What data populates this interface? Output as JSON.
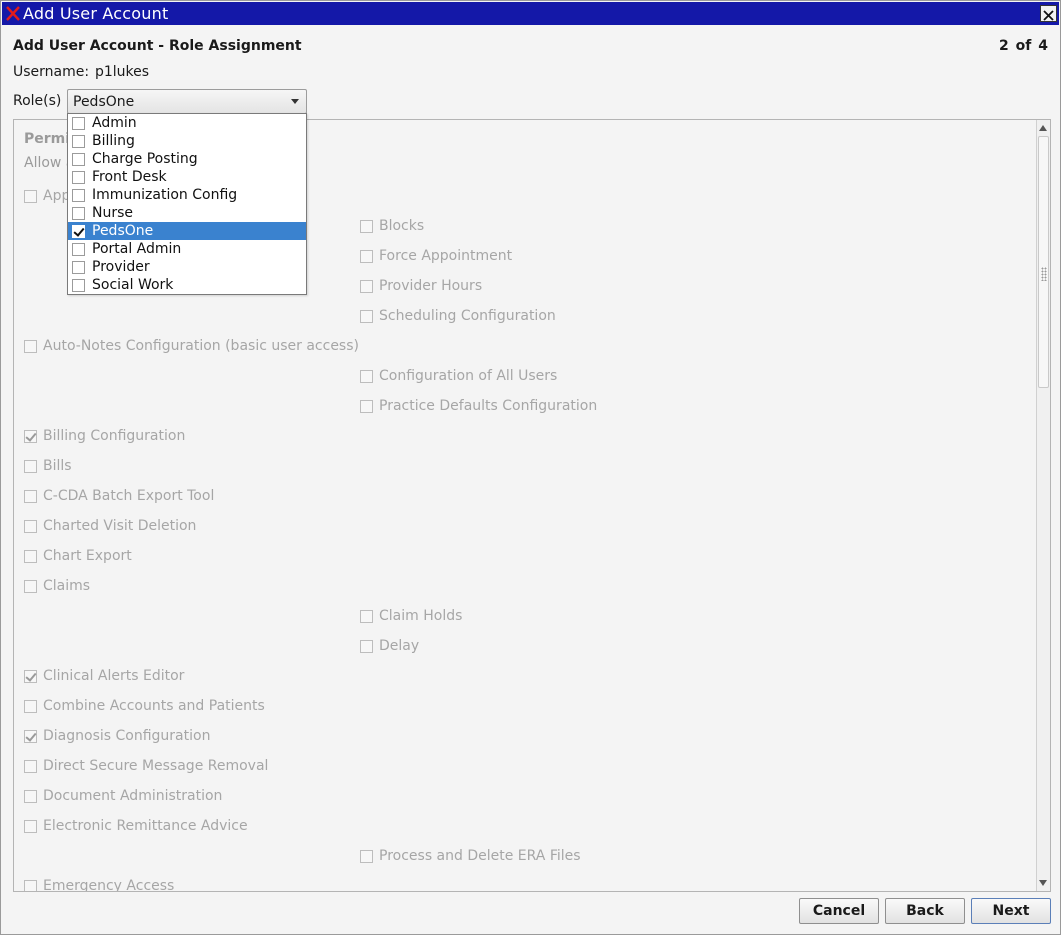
{
  "window": {
    "title": "Add User Account"
  },
  "header": {
    "heading": "Add User Account -  Role Assignment",
    "step": "2 of 4"
  },
  "username": {
    "label": "Username:",
    "value": "p1lukes"
  },
  "roles": {
    "label": "Role(s)",
    "selected": "PedsOne",
    "options": [
      {
        "label": "Admin",
        "checked": false
      },
      {
        "label": "Billing",
        "checked": false
      },
      {
        "label": "Charge Posting",
        "checked": false
      },
      {
        "label": "Front Desk",
        "checked": false
      },
      {
        "label": "Immunization Config",
        "checked": false
      },
      {
        "label": "Nurse",
        "checked": false
      },
      {
        "label": "PedsOne",
        "checked": true
      },
      {
        "label": "Portal Admin",
        "checked": false
      },
      {
        "label": "Provider",
        "checked": false
      },
      {
        "label": "Social Work",
        "checked": false
      }
    ]
  },
  "permissions": {
    "title": "Permis",
    "description": "Allow a",
    "items": [
      {
        "label": "App",
        "checked": false,
        "level": 0
      },
      {
        "label": "Blocks",
        "checked": false,
        "level": 1
      },
      {
        "label": "Force Appointment",
        "checked": false,
        "level": 1
      },
      {
        "label": "Provider Hours",
        "checked": false,
        "level": 1
      },
      {
        "label": "Scheduling Configuration",
        "checked": false,
        "level": 1
      },
      {
        "label": "Auto-Notes Configuration (basic user access)",
        "checked": false,
        "level": 0
      },
      {
        "label": "Configuration of All Users",
        "checked": false,
        "level": 1
      },
      {
        "label": "Practice Defaults Configuration",
        "checked": false,
        "level": 1
      },
      {
        "label": "Billing Configuration",
        "checked": true,
        "level": 0
      },
      {
        "label": "Bills",
        "checked": false,
        "level": 0
      },
      {
        "label": "C-CDA Batch Export Tool",
        "checked": false,
        "level": 0
      },
      {
        "label": "Charted Visit Deletion",
        "checked": false,
        "level": 0
      },
      {
        "label": "Chart Export",
        "checked": false,
        "level": 0
      },
      {
        "label": "Claims",
        "checked": false,
        "level": 0
      },
      {
        "label": "Claim Holds",
        "checked": false,
        "level": 1
      },
      {
        "label": "Delay",
        "checked": false,
        "level": 1
      },
      {
        "label": "Clinical Alerts Editor",
        "checked": true,
        "level": 0
      },
      {
        "label": "Combine Accounts and Patients",
        "checked": false,
        "level": 0
      },
      {
        "label": "Diagnosis Configuration",
        "checked": true,
        "level": 0
      },
      {
        "label": "Direct Secure Message Removal",
        "checked": false,
        "level": 0
      },
      {
        "label": "Document Administration",
        "checked": false,
        "level": 0
      },
      {
        "label": "Electronic Remittance Advice",
        "checked": false,
        "level": 0
      },
      {
        "label": "Process and Delete ERA Files",
        "checked": false,
        "level": 1
      },
      {
        "label": "Emergency Access",
        "checked": false,
        "level": 0
      }
    ]
  },
  "buttons": {
    "cancel": "Cancel",
    "back": "Back",
    "next": "Next"
  },
  "colors": {
    "titlebar": "#1418a8",
    "selection": "#3a82cf",
    "disabled_text": "#a6a6a6"
  }
}
